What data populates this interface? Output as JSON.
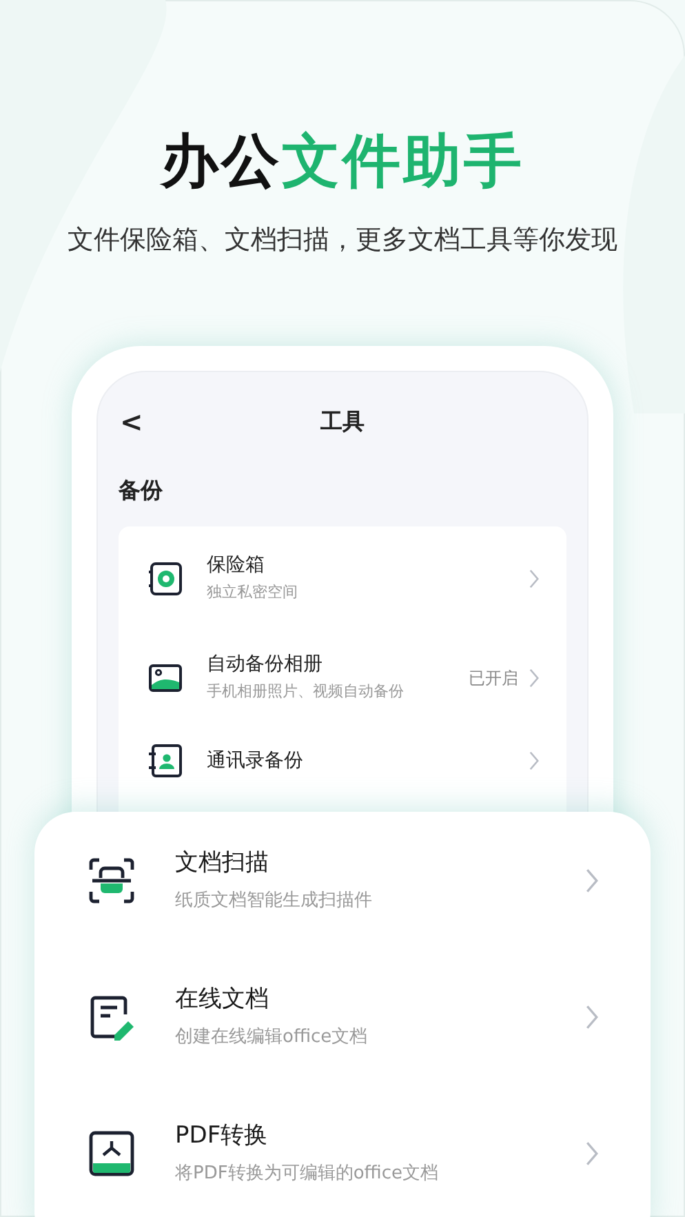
{
  "headline": [
    {
      "text": "办公",
      "color": "#111111"
    },
    {
      "text": "文件助手",
      "color": "#1eb46f"
    }
  ],
  "tagline": "文件保险箱、文档扫描，更多文档工具等你发现",
  "phone": {
    "back": "<",
    "title": "工具",
    "section": "备份",
    "items": [
      {
        "kind": "safe",
        "title": "保险箱",
        "subtitle": "独立私密空间"
      },
      {
        "kind": "album",
        "title": "自动备份相册",
        "subtitle": "手机相册照片、视频自动备份",
        "status": "已开启"
      },
      {
        "kind": "contacts",
        "title": "通讯录备份"
      }
    ]
  },
  "tools": [
    {
      "kind": "scan",
      "title": "文档扫描",
      "subtitle": "纸质文档智能生成扫描件"
    },
    {
      "kind": "edit",
      "title": "在线文档",
      "subtitle": "创建在线编辑office文档"
    },
    {
      "kind": "pdf",
      "title": "PDF转换",
      "subtitle": "将PDF转换为可编辑的office文档"
    }
  ]
}
